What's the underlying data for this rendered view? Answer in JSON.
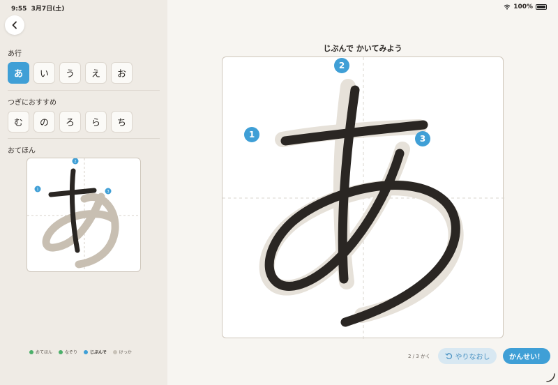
{
  "status": {
    "time": "9:55",
    "date": "3月7日(土)",
    "battery": "100%",
    "wifi_icon": "wifi-icon",
    "battery_icon": "battery-icon"
  },
  "sidebar": {
    "back_icon": "chevron-left-icon",
    "row_group": {
      "label": "あ行",
      "keys": [
        {
          "char": "あ",
          "selected": true
        },
        {
          "char": "い",
          "selected": false
        },
        {
          "char": "う",
          "selected": false
        },
        {
          "char": "え",
          "selected": false
        },
        {
          "char": "お",
          "selected": false
        }
      ]
    },
    "recommend": {
      "label": "つぎにおすすめ",
      "keys": [
        {
          "char": "む"
        },
        {
          "char": "の"
        },
        {
          "char": "ろ"
        },
        {
          "char": "ら"
        },
        {
          "char": "ち"
        }
      ]
    },
    "model": {
      "label": "おてほん",
      "stroke_numbers": [
        "1",
        "2",
        "3"
      ]
    },
    "legend": [
      {
        "label": "おてほん",
        "color": "#4caf6a"
      },
      {
        "label": "なぞり",
        "color": "#4caf6a"
      },
      {
        "label": "じぶんで",
        "color": "#3f9fd6",
        "bold": true
      },
      {
        "label": "けっか",
        "color": "#c8c2b8"
      }
    ]
  },
  "main": {
    "prompt": "じぶんで かいてみよう",
    "stroke_numbers": [
      "1",
      "2",
      "3"
    ],
    "stroke_counter": "2 / 3 かく",
    "redo_label": "やりなおし",
    "redo_icon": "undo-icon",
    "done_label": "かんせい！",
    "accent": "#3f9fd6",
    "ink": "#2a2623",
    "guide_stroke": "#e4dfd7"
  }
}
